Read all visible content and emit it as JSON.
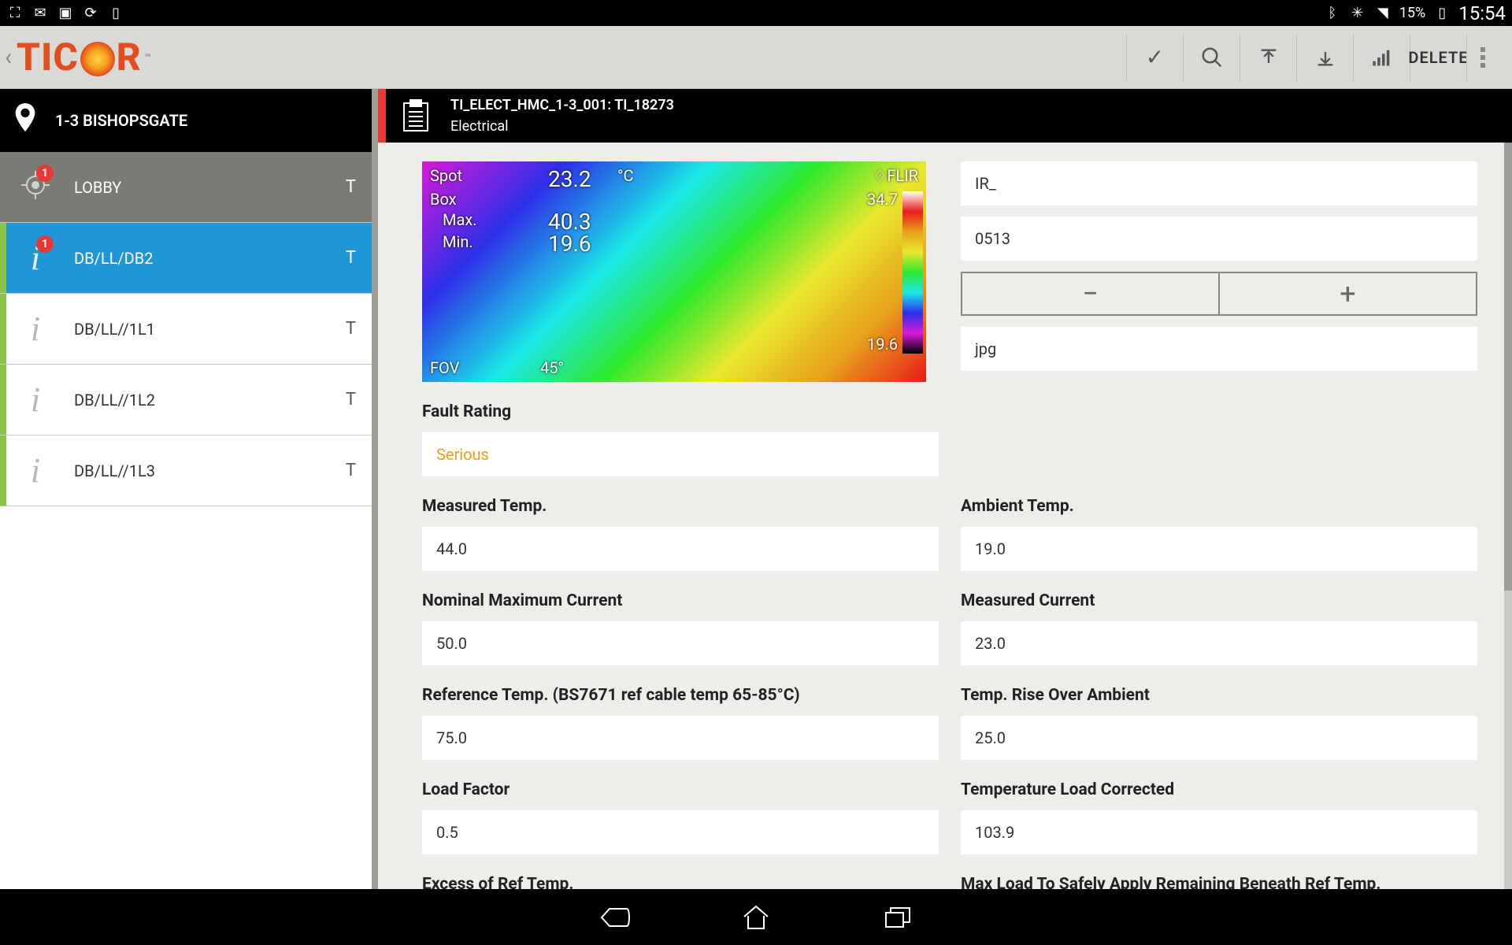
{
  "statusbar": {
    "battery": "15%",
    "time": "15:54"
  },
  "logo": {
    "pre": "TIC",
    "post": "R"
  },
  "actionbar": {
    "delete": "DELETE"
  },
  "site": {
    "name": "1-3 BISHOPSGATE"
  },
  "tree": {
    "lobby": {
      "label": "LOBBY",
      "t": "T",
      "badge": "1"
    },
    "items": [
      {
        "label": "DB/LL/DB2",
        "t": "T",
        "badge": "1"
      },
      {
        "label": "DB/LL//1L1",
        "t": "T"
      },
      {
        "label": "DB/LL//1L2",
        "t": "T"
      },
      {
        "label": "DB/LL//1L3",
        "t": "T"
      }
    ]
  },
  "header": {
    "code": "TI_ELECT_HMC_1-3_001: TI_18273",
    "cat": "Electrical"
  },
  "thermal": {
    "spot": "Spot",
    "box": "Box",
    "max": "Max.",
    "min": "Min.",
    "val_spot": "23.2",
    "val_max": "40.3",
    "val_min": "19.6",
    "unit": "°C",
    "brand": "♢FLIR",
    "fov": "FOV",
    "angle": "45°",
    "scale_hi": "34.7",
    "scale_lo": "19.6"
  },
  "inputs": {
    "prefix": "IR_",
    "num": "0513",
    "ext": "jpg"
  },
  "fields": {
    "fault_rating_label": "Fault Rating",
    "fault_rating": "Serious",
    "measured_temp_label": "Measured Temp.",
    "measured_temp": "44.0",
    "ambient_temp_label": "Ambient Temp.",
    "ambient_temp": "19.0",
    "nominal_max_current_label": "Nominal Maximum Current",
    "nominal_max_current": "50.0",
    "measured_current_label": "Measured Current",
    "measured_current": "23.0",
    "reference_temp_label": "Reference Temp. (BS7671 ref cable temp 65-85°C)",
    "reference_temp": "75.0",
    "temp_rise_label": "Temp. Rise Over Ambient",
    "temp_rise": "25.0",
    "load_factor_label": "Load Factor",
    "load_factor": "0.5",
    "temp_load_corrected_label": "Temperature Load Corrected",
    "temp_load_corrected": "103.9",
    "excess_ref_label": "Excess of Ref Temp.",
    "max_load_safe_label": "Max Load To Safely Apply Remaining Beneath Ref Temp."
  }
}
